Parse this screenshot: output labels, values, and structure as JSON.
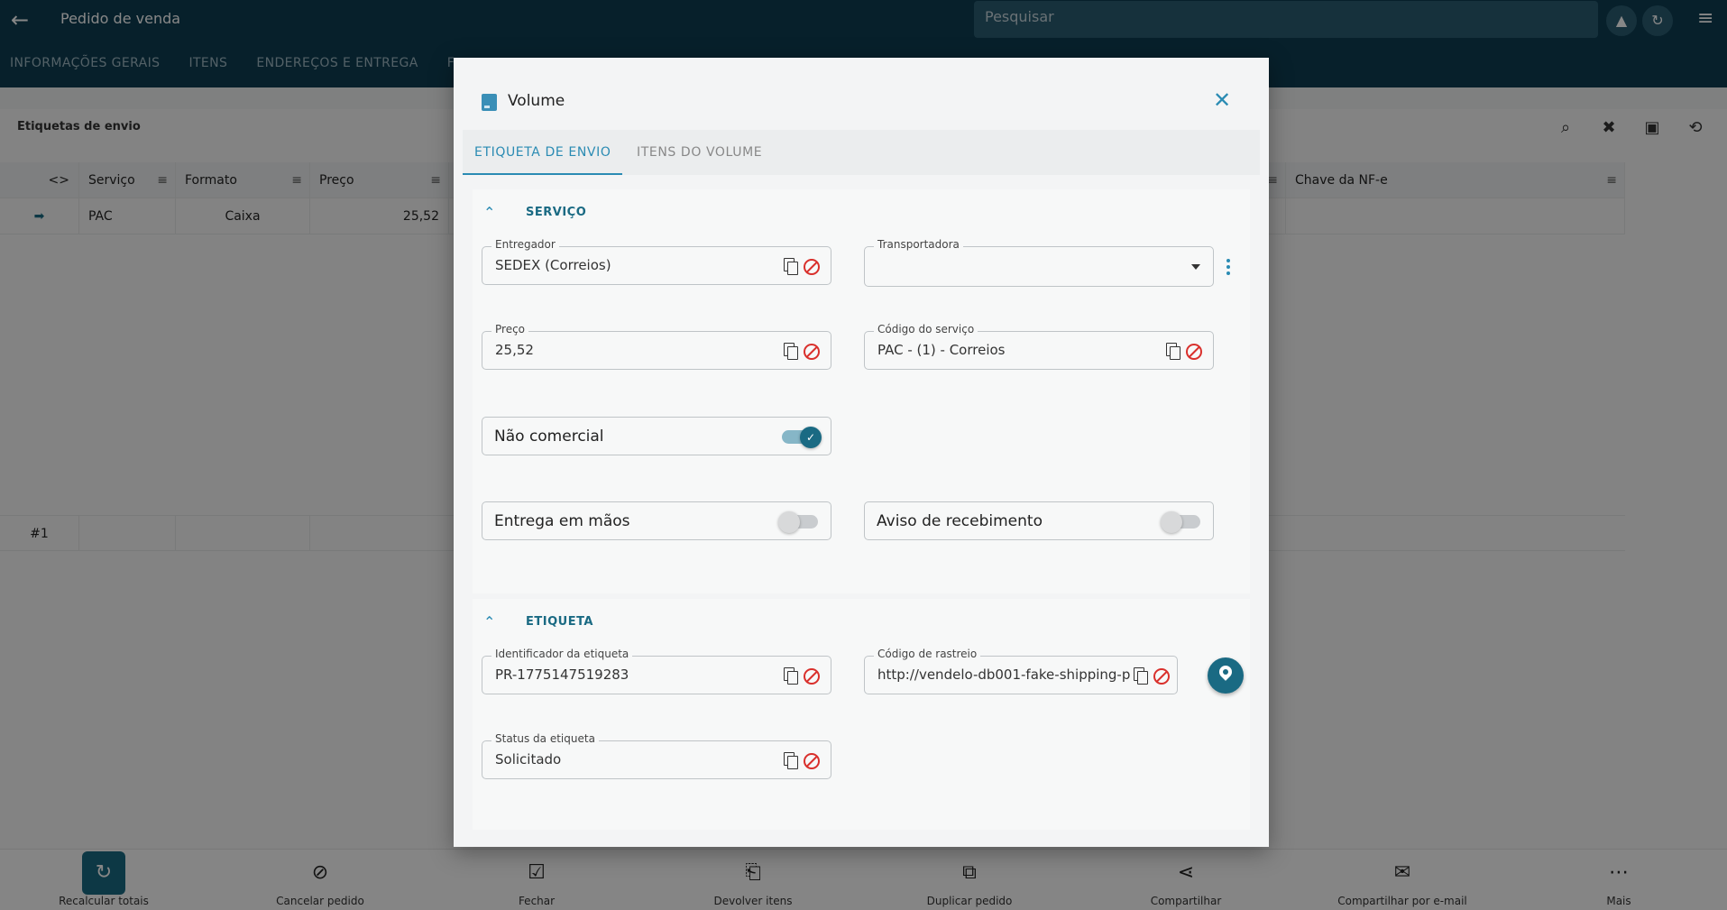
{
  "app": {
    "title": "Pedido de venda",
    "search_placeholder": "Pesquisar",
    "tabs": [
      "INFORMAÇÕES GERAIS",
      "ITENS",
      "ENDEREÇOS E ENTREGA",
      "F"
    ]
  },
  "panel": {
    "caption": "Etiquetas de envio",
    "columns": [
      "<>",
      "Serviço",
      "Formato",
      "Preço",
      "Chave da NF-e"
    ],
    "rows": [
      {
        "servico": "PAC",
        "formato": "Caixa",
        "preco": "25,52",
        "chave": ""
      }
    ],
    "footer_count": "#1"
  },
  "bottom_actions": [
    {
      "label": "Recalcular totais",
      "icon": "refresh-icon"
    },
    {
      "label": "Cancelar pedido",
      "icon": "block-icon"
    },
    {
      "label": "Fechar",
      "icon": "clipboard-check-icon"
    },
    {
      "label": "Devolver itens",
      "icon": "return-icon"
    },
    {
      "label": "Duplicar pedido",
      "icon": "copy-icon"
    },
    {
      "label": "Compartilhar",
      "icon": "share-icon"
    },
    {
      "label": "Compartilhar por e-mail",
      "icon": "mail-icon"
    },
    {
      "label": "Mais",
      "icon": "more-icon"
    }
  ],
  "dialog": {
    "title": "Volume",
    "tabs": [
      {
        "label": "ETIQUETA DE ENVIO",
        "active": true
      },
      {
        "label": "ITENS DO VOLUME",
        "active": false
      }
    ],
    "servico": {
      "title": "SERVIÇO",
      "entregador": {
        "label": "Entregador",
        "value": "SEDEX (Correios)"
      },
      "transportadora": {
        "label": "Transportadora",
        "value": ""
      },
      "preco": {
        "label": "Preço",
        "value": "25,52"
      },
      "codigo_servico": {
        "label": "Código do serviço",
        "value": "PAC - (1) - Correios"
      },
      "nao_comercial": {
        "label": "Não comercial",
        "on": true
      },
      "entrega_maos": {
        "label": "Entrega em mãos",
        "on": false
      },
      "aviso_recebimento": {
        "label": "Aviso de recebimento",
        "on": false
      }
    },
    "etiqueta": {
      "title": "ETIQUETA",
      "identificador": {
        "label": "Identificador da etiqueta",
        "value": "PR-1775147519283"
      },
      "rastreio": {
        "label": "Código de rastreio",
        "value": "http://vendelo-db001-fake-shipping-p"
      },
      "status": {
        "label": "Status da etiqueta",
        "value": "Solicitado"
      }
    }
  },
  "colors": {
    "header": "#0f3e52",
    "accent": "#2a8bb3",
    "primary_dark": "#1a6a83",
    "danger": "#d9302c"
  }
}
